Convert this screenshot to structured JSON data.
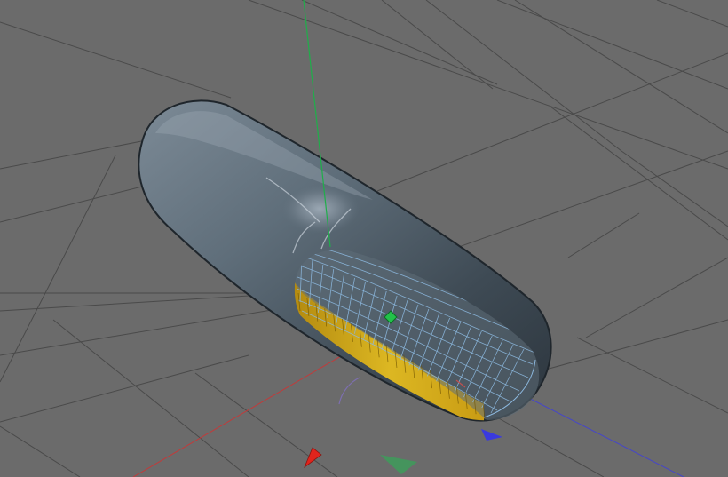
{
  "viewport": {
    "view": "perspective",
    "background_color": "#6b6b6b",
    "grid_color": "#4a4a4a"
  },
  "axes": {
    "x_color": "#d22a2a",
    "y_color": "#1fae4a",
    "z_color": "#4a4ad8"
  },
  "object": {
    "shape": "capsule",
    "surface_color": "#5e6d79",
    "selection_fill": "#d6b21e",
    "wire_color": "#89b4d8",
    "selected_region": "end-cap"
  },
  "gizmo": {
    "handles": [
      "x-axis-handle",
      "y-axis-handle",
      "z-axis-handle",
      "pivot-handle"
    ]
  }
}
